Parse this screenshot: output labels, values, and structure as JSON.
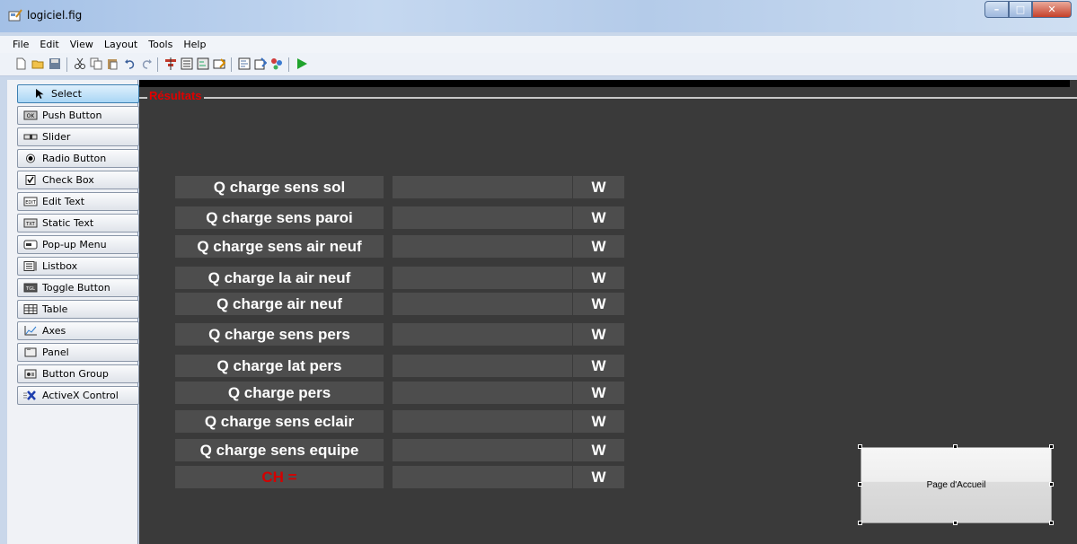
{
  "window": {
    "title": "logiciel.fig"
  },
  "menu": [
    "File",
    "Edit",
    "View",
    "Layout",
    "Tools",
    "Help"
  ],
  "palette": [
    {
      "label": "Select",
      "icon": "arrow-cursor-icon",
      "selected": true
    },
    {
      "label": "Push Button",
      "icon": "push-button-icon"
    },
    {
      "label": "Slider",
      "icon": "slider-icon"
    },
    {
      "label": "Radio Button",
      "icon": "radio-icon"
    },
    {
      "label": "Check Box",
      "icon": "checkbox-icon"
    },
    {
      "label": "Edit Text",
      "icon": "edit-text-icon"
    },
    {
      "label": "Static Text",
      "icon": "static-text-icon"
    },
    {
      "label": "Pop-up Menu",
      "icon": "popup-menu-icon"
    },
    {
      "label": "Listbox",
      "icon": "listbox-icon"
    },
    {
      "label": "Toggle Button",
      "icon": "toggle-icon"
    },
    {
      "label": "Table",
      "icon": "table-icon"
    },
    {
      "label": "Axes",
      "icon": "axes-icon"
    },
    {
      "label": "Panel",
      "icon": "panel-icon"
    },
    {
      "label": "Button Group",
      "icon": "button-group-icon"
    },
    {
      "label": "ActiveX Control",
      "icon": "activex-icon"
    }
  ],
  "canvas": {
    "panel_title": "Résultats",
    "rows": [
      {
        "label": "Q charge sens sol",
        "unit": "W"
      },
      {
        "label": "Q charge sens paroi",
        "unit": "W"
      },
      {
        "label": "Q charge sens air neuf",
        "unit": "W"
      },
      {
        "label": "Q charge la air neuf",
        "unit": "W"
      },
      {
        "label": "Q charge air neuf",
        "unit": "W"
      },
      {
        "label": "Q charge sens pers",
        "unit": "W"
      },
      {
        "label": "Q charge lat pers",
        "unit": "W"
      },
      {
        "label": "Q charge pers",
        "unit": "W"
      },
      {
        "label": "Q charge sens eclair",
        "unit": "W"
      },
      {
        "label": "Q charge sens equipe",
        "unit": "W"
      },
      {
        "label": "CH =",
        "unit": "W"
      }
    ],
    "home_button": "Page d'Accueil"
  },
  "colors": {
    "canvas_bg": "#3a3a3a",
    "box_bg": "#4d4d4d",
    "accent_red": "#d40000"
  }
}
